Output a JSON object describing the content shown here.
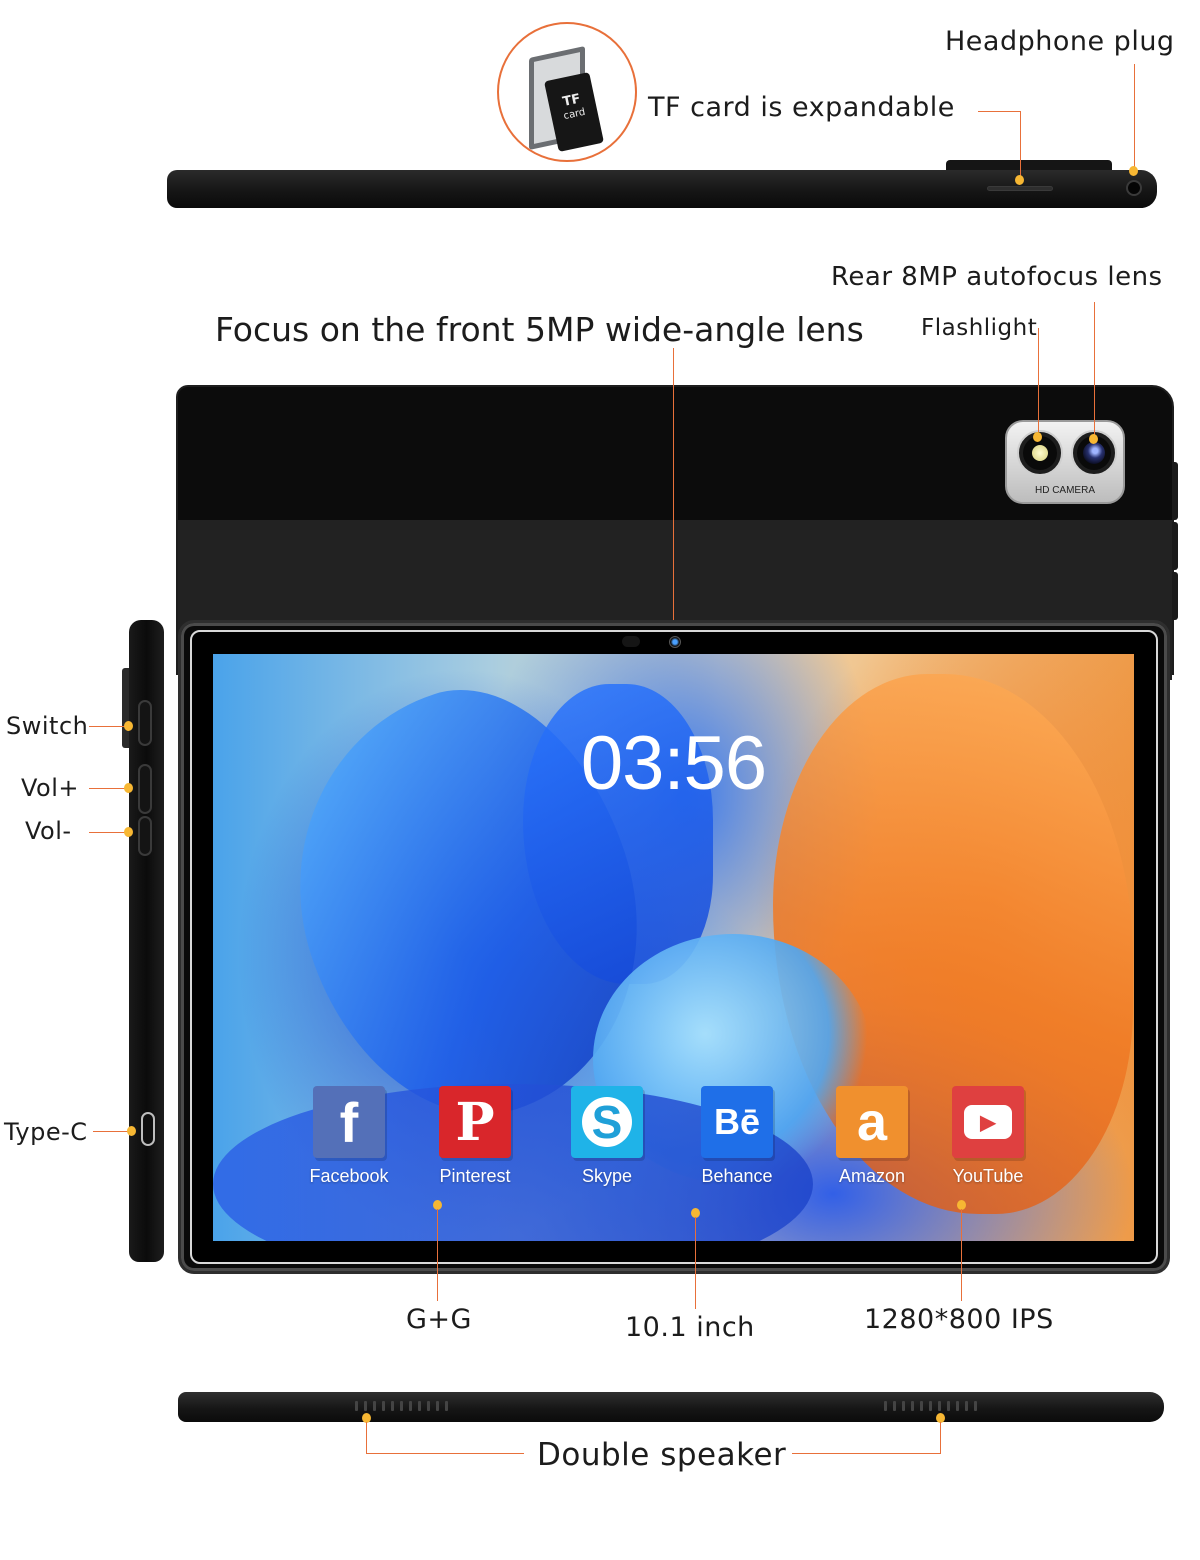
{
  "annotations": {
    "headphone_plug": "Headphone plug",
    "tf_card": "TF card is expandable",
    "rear_lens": "Rear 8MP autofocus lens",
    "flashlight": "Flashlight",
    "front_lens": "Focus on the front 5MP wide-angle lens",
    "switch": "Switch",
    "vol_up": "Vol+",
    "vol_down": "Vol-",
    "type_c": "Type-C",
    "glass": "G+G",
    "screen_size": "10.1 inch",
    "resolution": "1280*800 IPS",
    "speaker": "Double speaker"
  },
  "tf_card_graphic": {
    "line1": "TF",
    "line2": "card"
  },
  "camera_module": {
    "label": "HD CAMERA"
  },
  "screen": {
    "clock": "03:56",
    "apps": [
      {
        "name": "Facebook",
        "glyph": "f",
        "color": "#5470b8",
        "icon": "facebook-icon"
      },
      {
        "name": "Pinterest",
        "glyph": "P",
        "color": "#d9262b",
        "icon": "pinterest-icon"
      },
      {
        "name": "Skype",
        "glyph": "S",
        "color": "#1fb3e8",
        "icon": "skype-icon"
      },
      {
        "name": "Behance",
        "glyph": "Bē",
        "color": "#1f6fe8",
        "icon": "behance-icon"
      },
      {
        "name": "Amazon",
        "glyph": "a",
        "color": "#f0902e",
        "icon": "amazon-icon"
      },
      {
        "name": "YouTube",
        "glyph": "▶",
        "color": "#df4040",
        "icon": "youtube-icon"
      }
    ]
  },
  "colors": {
    "callout_line": "#e8703a",
    "callout_dot": "#f7b733"
  }
}
